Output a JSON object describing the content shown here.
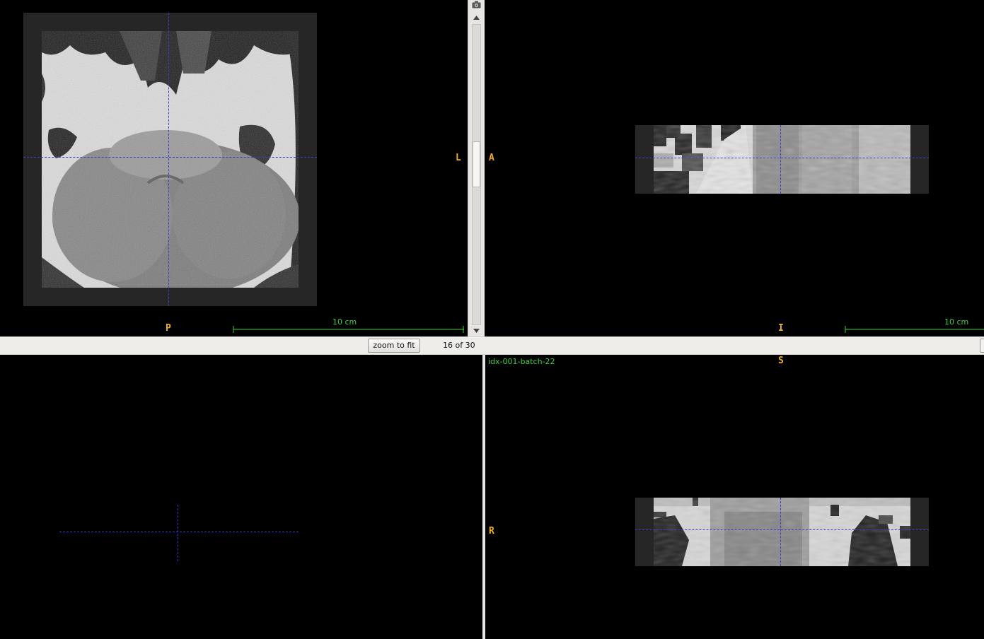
{
  "toolbar": {
    "zoom_button_label": "zoom to fit",
    "slice_counter": "16 of 30"
  },
  "axial_view": {
    "right_label": "L",
    "bottom_label": "P",
    "scale_label": "10 cm"
  },
  "sagittal_view": {
    "left_label": "A",
    "bottom_label": "I",
    "scale_label": "10 cm"
  },
  "coronal_view": {
    "series_name": "idx-001-batch-22",
    "top_label": "S",
    "left_label": "R"
  },
  "scrollbar": {
    "position_fraction": 0.3
  },
  "icons": {
    "camera": "camera-icon",
    "scroll_up": "arrow-up-icon",
    "scroll_down": "arrow-down-icon"
  },
  "colors": {
    "orientation_label": "#f2b01e",
    "scale_bar": "#3bd23b",
    "crosshair": "#3a3ad8",
    "series_label": "#3bd23b"
  }
}
